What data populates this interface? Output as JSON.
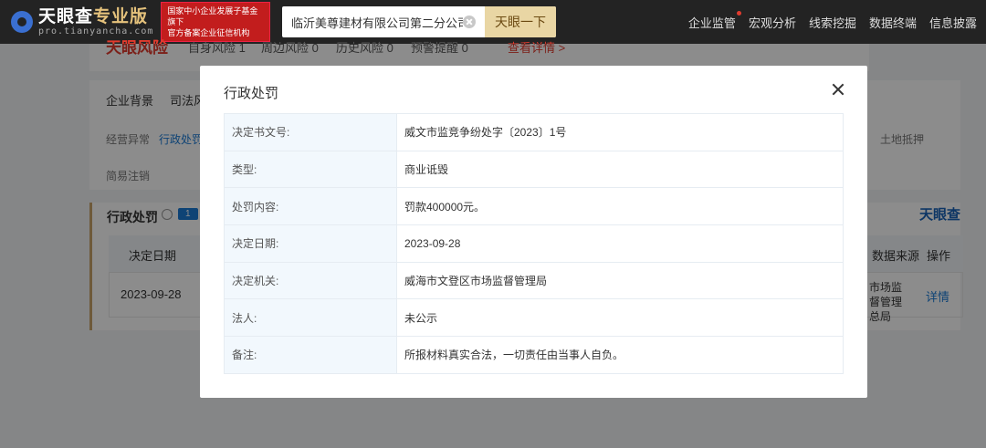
{
  "header": {
    "logo_main": "天眼查",
    "logo_pro": "专业版",
    "logo_sub": "pro.tianyancha.com",
    "badge_line1": "国家中小企业发展子基金旗下",
    "badge_line2": "官方备案企业征信机构",
    "search_value": "临沂美尊建材有限公司第二分公司",
    "search_button": "天眼一下",
    "nav": [
      "企业监管",
      "宏观分析",
      "线索挖掘",
      "数据终端",
      "信息披露"
    ]
  },
  "background": {
    "risk_title": "天眼风险",
    "risk_items": [
      "自身风险 1",
      "周边风险 0",
      "历史风险 0",
      "预警提醒 0"
    ],
    "risk_link": "查看详情 >",
    "main_tabs": [
      "企业背景",
      "司法风"
    ],
    "sub_tabs": [
      "经营异常",
      "行政处罚"
    ],
    "sub_tab_right": "土地抵押",
    "sub_tab_row2": "简易注销",
    "section_title": "行政处罚",
    "section_count": "1",
    "brand": "天眼查",
    "col_date": "决定日期",
    "col_source": "数据来源",
    "col_action": "操作",
    "row_date": "2023-09-28",
    "row_source": "市场监督管理总局",
    "row_action": "详情"
  },
  "modal": {
    "title": "行政处罚",
    "rows": [
      {
        "label": "决定书文号:",
        "value": "威文市监竞争纷处字〔2023〕1号"
      },
      {
        "label": "类型:",
        "value": "商业诋毁"
      },
      {
        "label": "处罚内容:",
        "value": "罚款400000元。"
      },
      {
        "label": "决定日期:",
        "value": "2023-09-28"
      },
      {
        "label": "决定机关:",
        "value": "威海市文登区市场监督管理局"
      },
      {
        "label": "法人:",
        "value": "未公示"
      },
      {
        "label": "备注:",
        "value": "所报材料真实合法，一切责任由当事人自负。"
      }
    ]
  }
}
